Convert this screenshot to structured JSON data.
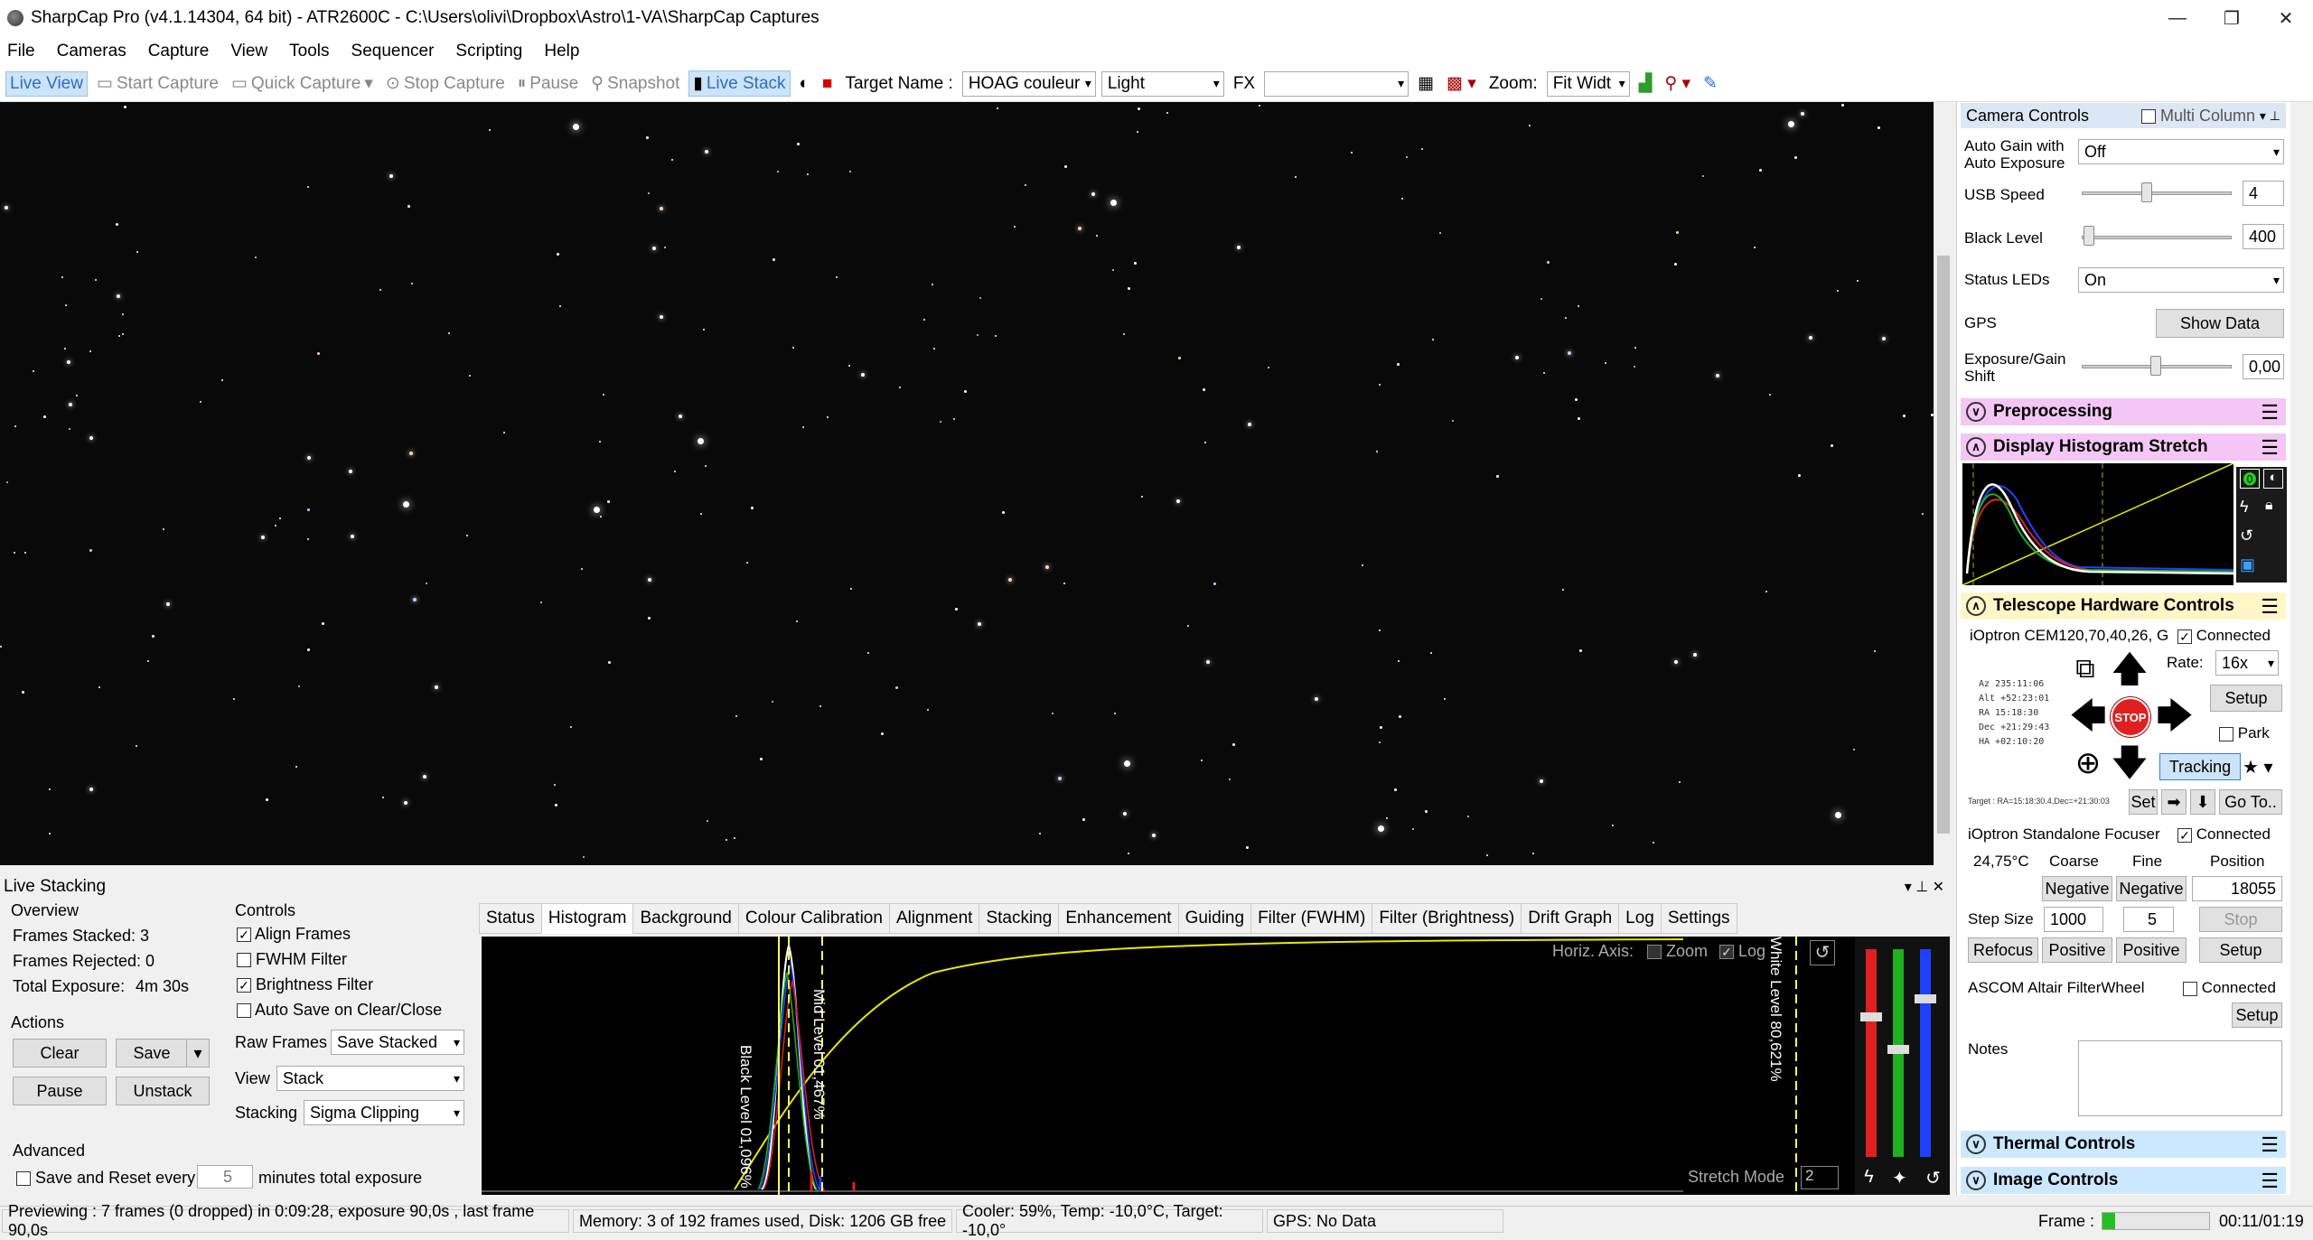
{
  "window": {
    "title": "SharpCap Pro (v4.1.14304, 64 bit) - ATR2600C - C:\\Users\\olivi\\Dropbox\\Astro\\1-VA\\SharpCap Captures"
  },
  "menu": [
    "File",
    "Cameras",
    "Capture",
    "View",
    "Tools",
    "Sequencer",
    "Scripting",
    "Help"
  ],
  "toolbar": {
    "live_view": "Live View",
    "start_capture": "Start Capture",
    "quick_capture": "Quick Capture",
    "stop_capture": "Stop Capture",
    "pause": "Pause",
    "snapshot": "Snapshot",
    "live_stack": "Live Stack",
    "target_label": "Target Name :",
    "target_value": "HOAG couleur",
    "frame_type": "Light",
    "fx_label": "FX",
    "fx_value": "",
    "zoom_label": "Zoom:",
    "zoom_value": "Fit Widt"
  },
  "camera_controls": {
    "header": "Camera Controls",
    "multi_column": "Multi Column",
    "auto_gain_label": "Auto Gain with Auto Exposure",
    "auto_gain_value": "Off",
    "usb_speed_label": "USB Speed",
    "usb_speed_value": "4",
    "black_level_label": "Black Level",
    "black_level_value": "400",
    "status_leds_label": "Status LEDs",
    "status_leds_value": "On",
    "gps_label": "GPS",
    "show_data": "Show Data",
    "exposure_shift_label": "Exposure/Gain Shift",
    "exposure_shift_value": "0,00"
  },
  "sections": {
    "preprocessing": "Preprocessing",
    "histogram_stretch": "Display Histogram Stretch",
    "telescope": "Telescope Hardware Controls",
    "thermal": "Thermal Controls",
    "image": "Image Controls"
  },
  "mount": {
    "name": "iOptron CEM120,70,40,26, G",
    "connected": "Connected",
    "rate_label": "Rate:",
    "rate_value": "16x",
    "setup": "Setup",
    "park": "Park",
    "tracking": "Tracking",
    "stop": "STOP",
    "coords": [
      "Az  235:11:06",
      "Alt +52:23:01",
      "RA   15:18:30",
      "Dec +21:29:43",
      "HA  +02:10:20"
    ],
    "target": "Target : RA=15:18:30.4,Dec=+21:30:03",
    "set": "Set",
    "goto": "Go To.."
  },
  "focuser": {
    "name": "iOptron Standalone Focuser",
    "connected": "Connected",
    "temp": "24,75°C",
    "coarse": "Coarse",
    "fine": "Fine",
    "position_label": "Position",
    "neg1": "Negative",
    "neg2": "Negative",
    "position_value": "18055",
    "step_label": "Step Size",
    "step_value": "1000",
    "fine_step": "5",
    "stop": "Stop",
    "refocus": "Refocus",
    "pos1": "Positive",
    "pos2": "Positive",
    "setup": "Setup"
  },
  "filterwheel": {
    "name": "ASCOM Altair FilterWheel",
    "connected": "Connected",
    "setup": "Setup"
  },
  "notes_label": "Notes",
  "live_stacking": {
    "title": "Live Stacking",
    "overview": "Overview",
    "frames_stacked": "Frames Stacked:  3",
    "frames_rejected": "Frames Rejected: 0",
    "total_exposure": "Total Exposure:",
    "total_exposure_value": "4m 30s",
    "actions": "Actions",
    "clear": "Clear",
    "save": "Save",
    "pause": "Pause",
    "unstack": "Unstack",
    "advanced": "Advanced",
    "save_reset": "Save and Reset every",
    "save_reset_value": "5",
    "minutes": "minutes total exposure",
    "controls": "Controls",
    "align": "Align Frames",
    "fwhm": "FWHM Filter",
    "brightness": "Brightness Filter",
    "autosave": "Auto Save on Clear/Close",
    "raw_frames_label": "Raw Frames",
    "raw_frames_value": "Save Stacked",
    "view_label": "View",
    "view_value": "Stack",
    "stacking_label": "Stacking",
    "stacking_value": "Sigma Clipping",
    "tabs": [
      "Status",
      "Histogram",
      "Background",
      "Colour Calibration",
      "Alignment",
      "Stacking",
      "Enhancement",
      "Guiding",
      "Filter (FWHM)",
      "Filter (Brightness)",
      "Drift Graph",
      "Log",
      "Settings"
    ],
    "horiz_axis": "Horiz. Axis:",
    "zoom": "Zoom",
    "log": "Log",
    "black_level": "Black Level 01,096%",
    "mid_level": "Mid Level 01,467%",
    "white_level": "White Level 80,621%",
    "stretch_mode": "Stretch Mode",
    "stretch_value": "2"
  },
  "status": {
    "preview": "Previewing : 7 frames (0 dropped) in 0:09:28, exposure 90,0s , last frame 90,0s",
    "memory": "Memory: 3 of 192 frames used, Disk: 1206 GB free",
    "cooler": "Cooler: 59%, Temp: -10,0°C, Target: -10,0°",
    "gps": "GPS: No Data",
    "frame_label": "Frame :",
    "time": "00:11/01:19"
  },
  "colors": {
    "accent": "#2a6fbf",
    "preprocessing": "#f3c6f5",
    "histogram": "#f3c6f5",
    "telescope": "#fff6c8",
    "thermal": "#cce8ff",
    "image": "#cce8ff",
    "stop": "#e02020",
    "frame_progress": "#22c022"
  }
}
